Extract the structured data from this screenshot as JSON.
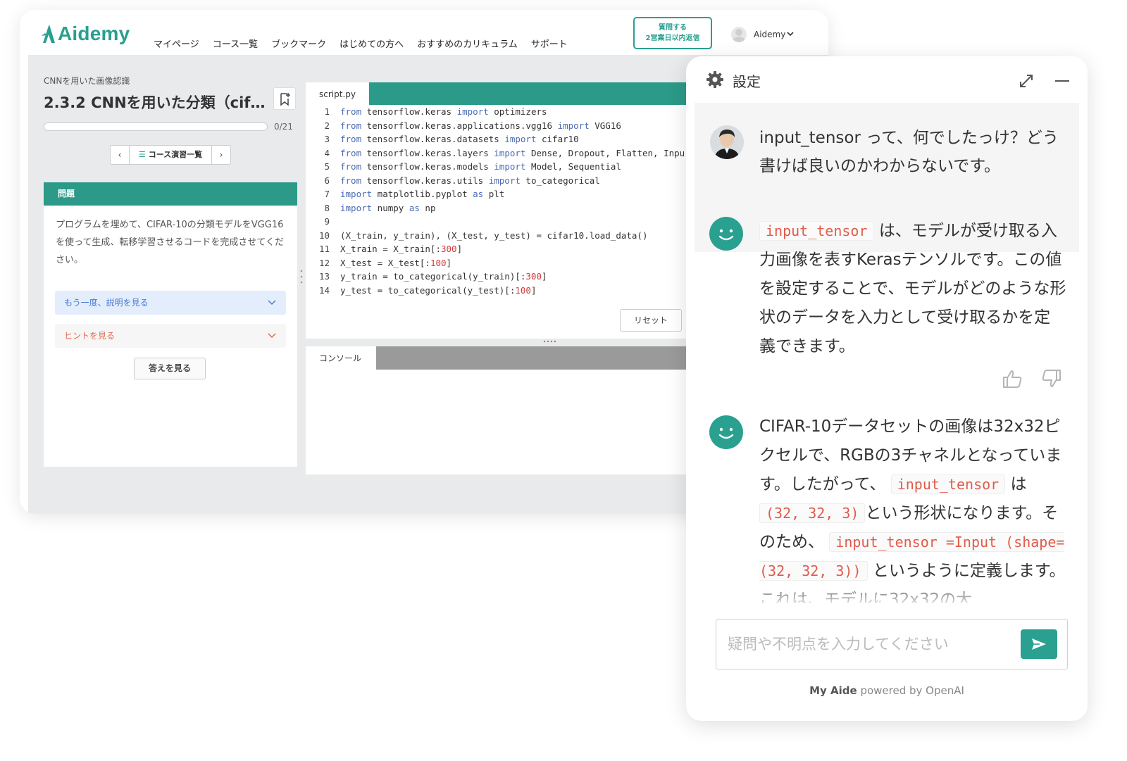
{
  "brand": {
    "name": "Aidemy",
    "color": "#27a08e"
  },
  "nav": {
    "links": [
      "マイページ",
      "コース一覧",
      "ブックマーク",
      "はじめての方へ",
      "おすすめのカリキュラム",
      "サポート"
    ],
    "ask_button": {
      "line1": "質問する",
      "line2": "2営業日以内返信"
    },
    "user_name": "Aidemy"
  },
  "lesson": {
    "breadcrumb": "CNNを用いた画像認識",
    "title": "2.3.2 CNNを用いた分類（cif…",
    "progress": {
      "current": 0,
      "total": 21,
      "label": "0/21"
    },
    "exercise_nav": {
      "prev": "‹",
      "list_label": "コース演習一覧",
      "next": "›"
    }
  },
  "problem": {
    "header": "問題",
    "text": "プログラムを埋めて、CIFAR-10の分類モデルをVGG16を使って生成、転移学習させるコードを完成させてください。",
    "explain_toggle": "もう一度、説明を見る",
    "hint_toggle": "ヒントを見る",
    "answer_button": "答えを見る"
  },
  "editor": {
    "tab": "script.py",
    "reset_button": "リセット",
    "lines": [
      [
        [
          "kw",
          "from"
        ],
        [
          "tx",
          " tensorflow.keras "
        ],
        [
          "kw",
          "import"
        ],
        [
          "tx",
          " optimizers"
        ]
      ],
      [
        [
          "kw",
          "from"
        ],
        [
          "tx",
          " tensorflow.keras.applications.vgg16 "
        ],
        [
          "kw",
          "import"
        ],
        [
          "tx",
          " VGG16"
        ]
      ],
      [
        [
          "kw",
          "from"
        ],
        [
          "tx",
          " tensorflow.keras.datasets "
        ],
        [
          "kw",
          "import"
        ],
        [
          "tx",
          " cifar10"
        ]
      ],
      [
        [
          "kw",
          "from"
        ],
        [
          "tx",
          " tensorflow.keras.layers "
        ],
        [
          "kw",
          "import"
        ],
        [
          "tx",
          " Dense, Dropout, Flatten, Inpu"
        ]
      ],
      [
        [
          "kw",
          "from"
        ],
        [
          "tx",
          " tensorflow.keras.models "
        ],
        [
          "kw",
          "import"
        ],
        [
          "tx",
          " Model, Sequential"
        ]
      ],
      [
        [
          "kw",
          "from"
        ],
        [
          "tx",
          " tensorflow.keras.utils "
        ],
        [
          "kw",
          "import"
        ],
        [
          "tx",
          " to_categorical"
        ]
      ],
      [
        [
          "kw",
          "import"
        ],
        [
          "tx",
          " matplotlib.pyplot "
        ],
        [
          "kw",
          "as"
        ],
        [
          "tx",
          " plt"
        ]
      ],
      [
        [
          "kw",
          "import"
        ],
        [
          "tx",
          " numpy "
        ],
        [
          "kw",
          "as"
        ],
        [
          "tx",
          " np"
        ]
      ],
      [],
      [
        [
          "tx",
          "(X_train, y_train), (X_test, y_test) = cifar10.load_data()"
        ]
      ],
      [
        [
          "tx",
          "X_train = X_train[:"
        ],
        [
          "num",
          "300"
        ],
        [
          "tx",
          "]"
        ]
      ],
      [
        [
          "tx",
          "X_test = X_test[:"
        ],
        [
          "num",
          "100"
        ],
        [
          "tx",
          "]"
        ]
      ],
      [
        [
          "tx",
          "y_train = to_categorical(y_train)[:"
        ],
        [
          "num",
          "300"
        ],
        [
          "tx",
          "]"
        ]
      ],
      [
        [
          "tx",
          "y_test = to_categorical(y_test)[:"
        ],
        [
          "num",
          "100"
        ],
        [
          "tx",
          "]"
        ]
      ]
    ]
  },
  "console": {
    "tab": "コンソール"
  },
  "chat": {
    "title": "設定",
    "user_message": "input_tensor って、何でしたっけ？どう書けば良いのかわからないです。",
    "bot_message_1": {
      "code": "input_tensor",
      "text": "は、モデルが受け取る入力画像を表すKerasテンソルです。この値を設定することで、モデルがどのような形状のデータを入力として受け取るかを定義できます。"
    },
    "bot_message_2": {
      "part1": "CIFAR-10データセットの画像は32x32ピクセルで、RGBの3チャネルとなっています。したがって、",
      "code1": "input_tensor",
      "part2": "は",
      "code2": "(32, 32, 3)",
      "part3": "という形状になります。そのため、",
      "code3": "input_tensor =Input (shape=(32, 32, 3))",
      "part4": "というように定義します。これは、モデルに32x32の大"
    },
    "input_placeholder": "疑問や不明点を入力してください",
    "powered_brand": "My Aide",
    "powered_text": "powered by OpenAI",
    "accent": "#2aa090"
  }
}
